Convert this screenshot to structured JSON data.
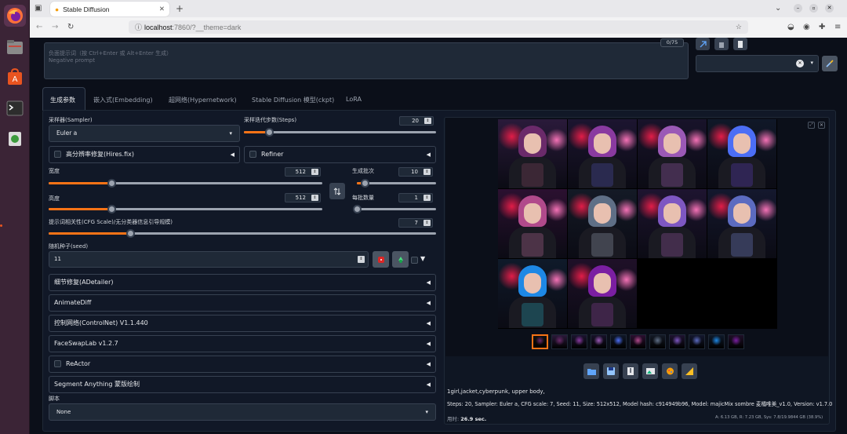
{
  "browser": {
    "tab_title": "Stable Diffusion",
    "url_host": "localhost",
    "url_rest": ":7860/?__theme=dark"
  },
  "prompt": {
    "placeholder_cn": "负面提示词（按 Ctrl+Enter 或 Alt+Enter 生成）",
    "placeholder_en": "Negative prompt",
    "token_counter": "0/75"
  },
  "tabs": [
    "生成参数",
    "嵌入式(Embedding)",
    "超网络(Hypernetwork)",
    "Stable Diffusion 模型(ckpt)",
    "LoRA"
  ],
  "params": {
    "sampler_label": "采样器(Sampler)",
    "sampler_value": "Euler a",
    "steps_label": "采样迭代步数(Steps)",
    "steps_value": "20",
    "steps_fraction": 0.13,
    "hires_label": "高分辨率修复(Hires.fix)",
    "refiner_label": "Refiner",
    "width_label": "宽度",
    "width_value": "512",
    "width_fraction": 0.23,
    "height_label": "高度",
    "height_value": "512",
    "height_fraction": 0.23,
    "batch_count_label": "生成批次",
    "batch_count_value": "10",
    "batch_count_fraction": 0.1,
    "batch_size_label": "每批数量",
    "batch_size_value": "1",
    "batch_size_fraction": 0.0,
    "cfg_label": "提示词相关性(CFG Scale)/无分类器信息引导规模)",
    "cfg_value": "7",
    "cfg_fraction": 0.21,
    "seed_label": "随机种子(seed)",
    "seed_value": "11",
    "script_label": "脚本",
    "script_value": "None"
  },
  "accordions": [
    "细节修复(ADetailer)",
    "AnimateDiff",
    "控制网络(ControlNet) V1.1.440",
    "FaceSwapLab v1.2.7",
    "ReActor",
    "Segment Anything 蒙版绘制"
  ],
  "output": {
    "prompt_text": "1girl,jacket,cyberpunk, upper body,",
    "info_text": "Steps: 20, Sampler: Euler a, CFG scale: 7, Seed: 11, Size: 512x512, Model hash: c914949b96, Model: majicMix sombre 麦橘唯美_v1.0, Version: v1.7.0",
    "time_label": "用时:",
    "time_value": "26.9 sec.",
    "vram_text": "A: 6.13 GB, R: 7.23 GB, Sys: 7.8/19.9844 GB (38.9%)"
  },
  "icons": {
    "swap": "swap-dimensions-icon",
    "dice": "dice-icon",
    "recycle": "recycle-icon",
    "folder": "folder-icon",
    "save": "save-icon",
    "zip": "zip-icon",
    "img2img": "send-to-img2img-icon",
    "inpaint": "send-to-inpaint-icon",
    "extras": "send-to-extras-icon"
  },
  "colors": {
    "accent": "#f97316",
    "background": "#0b0f19",
    "panel": "#111827"
  }
}
